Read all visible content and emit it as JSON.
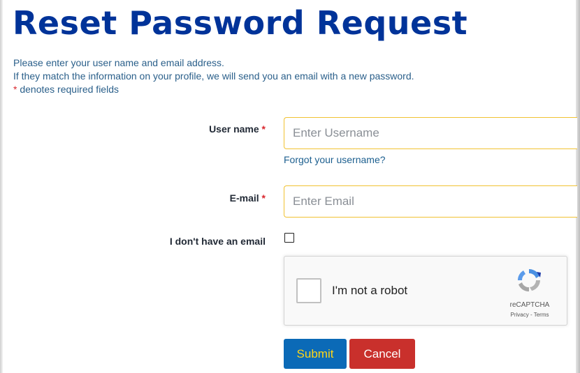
{
  "page": {
    "title": "Reset Password Request",
    "intro_line1": "Please enter your user name and email address.",
    "intro_line2": "If they match the information on your profile, we will send you an email with a new password.",
    "required_marker": "*",
    "required_note": " denotes required fields"
  },
  "form": {
    "username": {
      "label": "User name",
      "required_marker": "*",
      "placeholder": "Enter Username",
      "value": "",
      "forgot_link": "Forgot your username?"
    },
    "email": {
      "label": "E-mail",
      "required_marker": "*",
      "placeholder": "Enter Email",
      "value": ""
    },
    "no_email": {
      "label": "I don't have an email",
      "checked": false
    },
    "recaptcha": {
      "checkbox_label": "I'm not a robot",
      "brand": "reCAPTCHA",
      "privacy_link": "Privacy",
      "separator": " - ",
      "terms_link": "Terms",
      "checked": false
    },
    "buttons": {
      "submit_label": "Submit",
      "cancel_label": "Cancel"
    }
  },
  "colors": {
    "title": "#003399",
    "intro_text": "#2a5f8a",
    "required_star": "#d9272e",
    "input_border": "#f1c232",
    "submit_bg": "#0b6ab7",
    "submit_text": "#ffd617",
    "cancel_bg": "#c9302c",
    "cancel_text": "#ffffff"
  },
  "icons": {
    "recaptcha_logo": "recaptcha-logo-icon"
  }
}
